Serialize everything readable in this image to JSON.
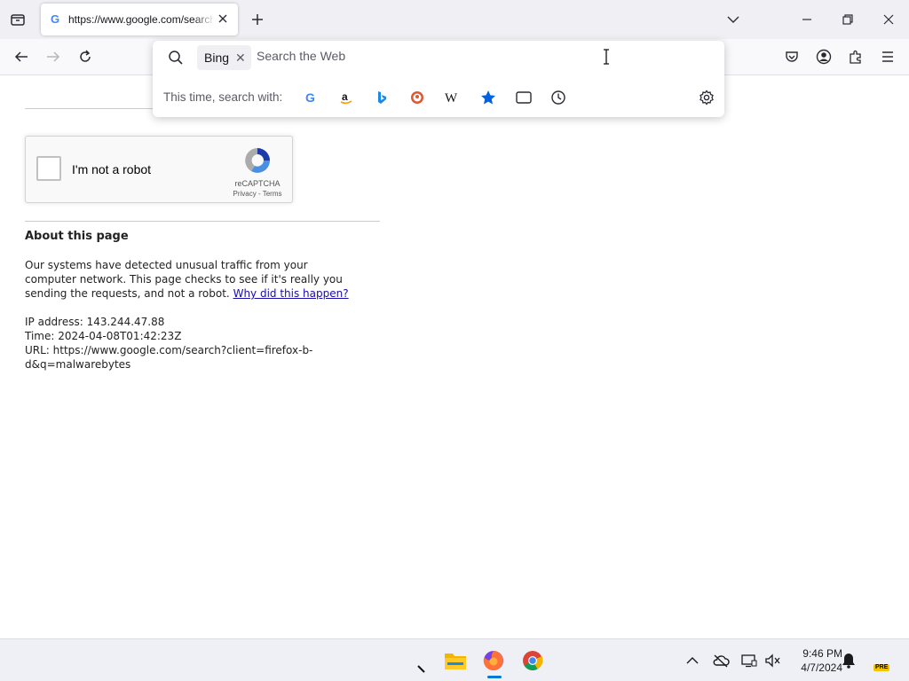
{
  "browser": {
    "tab": {
      "title": "https://www.google.com/search?client=firefox-b-d&q=malwarebytes"
    }
  },
  "urlbar": {
    "engine_chip": "Bing",
    "placeholder": "Search the Web",
    "oneoff_label": "This time, search with:",
    "engines": [
      "google-icon",
      "amazon-icon",
      "bing-icon",
      "duckduckgo-icon",
      "wikipedia-icon",
      "bookmarks-icon",
      "tabs-icon",
      "history-icon"
    ]
  },
  "page": {
    "captcha": {
      "label": "I'm not a robot",
      "brand": "reCAPTCHA",
      "privacy": "Privacy",
      "sep": " - ",
      "terms": "Terms"
    },
    "about_title": "About this page",
    "about_text": "Our systems have detected unusual traffic from your computer network. This page checks to see if it's really you sending the requests, and not a robot.",
    "why_link": "Why did this happen?",
    "ip_line": "IP address: 143.244.47.88",
    "time_line": "Time: 2024-04-08T01:42:23Z",
    "url_line": "URL: https://www.google.com/search?client=firefox-b-d&q=malwarebytes"
  },
  "taskbar": {
    "time": "9:46 PM",
    "date": "4/7/2024",
    "badge": "PRE"
  },
  "colors": {
    "accent": "#0060df",
    "link": "#1a0dab"
  }
}
